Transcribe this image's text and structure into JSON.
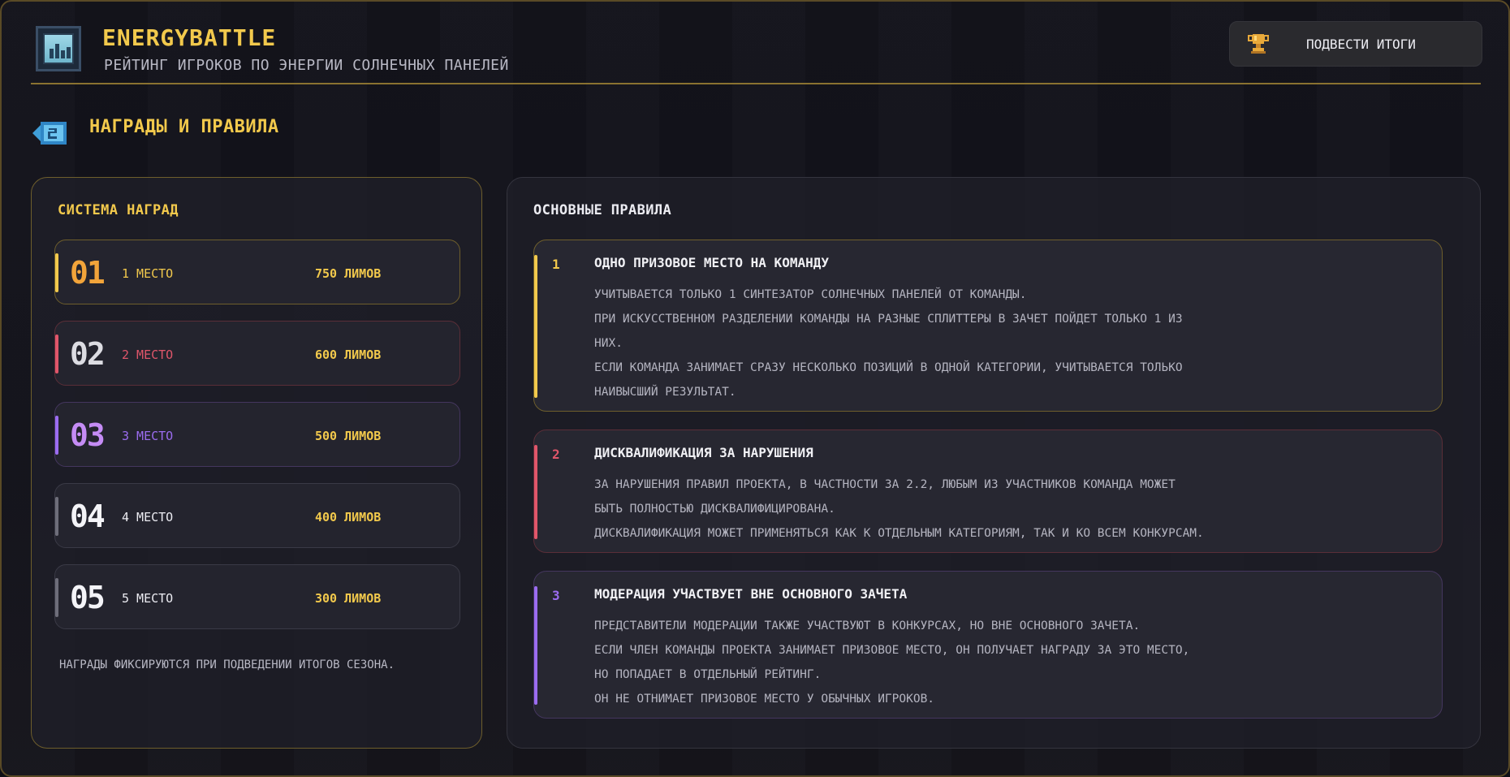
{
  "header": {
    "title": "EnergyBattle",
    "subtitle": "Рейтинг игроков по энергии солнечных панелей",
    "summarize_button": "Подвести итоги"
  },
  "section": {
    "title": "Награды и правила"
  },
  "rewards": {
    "title": "Система наград",
    "prizes": [
      {
        "num": "01",
        "place": "1 место",
        "amount": "750 лимов"
      },
      {
        "num": "02",
        "place": "2 место",
        "amount": "600 лимов"
      },
      {
        "num": "03",
        "place": "3 место",
        "amount": "500 лимов"
      },
      {
        "num": "04",
        "place": "4 место",
        "amount": "400 лимов"
      },
      {
        "num": "05",
        "place": "5 место",
        "amount": "300 лимов"
      }
    ],
    "note": "Награды фиксируются при подведении итогов сезона."
  },
  "rules": {
    "title": "Основные правила",
    "items": [
      {
        "index": "1",
        "title": "Одно призовое место на команду",
        "lines": [
          "Учитывается только 1 синтезатор солнечных панелей от команды.",
          "При искусственном разделении команды на разные сплиттеры в зачет пойдет только 1 из",
          "них.",
          "Если команда занимает сразу несколько позиций в одной категории, учитывается только",
          "наивысший результат."
        ]
      },
      {
        "index": "2",
        "title": "Дисквалификация за нарушения",
        "lines": [
          "За нарушения правил проекта, в частности за 2.2, любым из участников команда может",
          "быть полностью дисквалифицирована.",
          "Дисквалификация может применяться как к отдельным категориям, так и ко всем конкурсам."
        ]
      },
      {
        "index": "3",
        "title": "Модерация участвует вне основного зачета",
        "lines": [
          "Представители модерации также участвуют в конкурсах, но вне основного зачета.",
          "Если член команды проекта занимает призовое место, он получает награду за это место,",
          "но попадает в отдельный рейтинг.",
          "Он не отнимает призовое место у обычных игроков."
        ]
      }
    ]
  },
  "colors": {
    "gold": "#f2c94c",
    "red": "#e0566a",
    "purple": "#9b6cf0",
    "gray": "#8a8a96"
  },
  "icons": {
    "logo": "dashboard-logo-icon",
    "trophy": "trophy-icon",
    "section": "rewards-section-icon"
  }
}
